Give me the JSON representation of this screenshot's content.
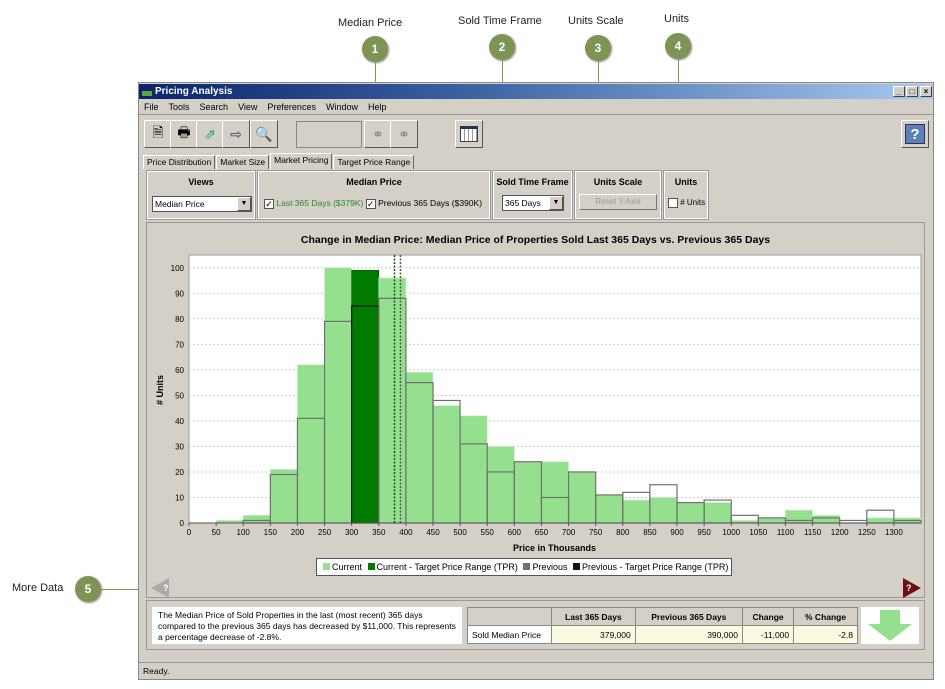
{
  "callouts": [
    {
      "num": "1",
      "label": "Median Price"
    },
    {
      "num": "2",
      "label": "Sold Time Frame"
    },
    {
      "num": "3",
      "label": "Units Scale"
    },
    {
      "num": "4",
      "label": "Units"
    },
    {
      "num": "5",
      "label": "More Data"
    }
  ],
  "window": {
    "title": "Pricing Analysis",
    "controls": [
      "_",
      "□",
      "×"
    ]
  },
  "menu": [
    "File",
    "Tools",
    "Search",
    "View",
    "Preferences",
    "Window",
    "Help"
  ],
  "toolbar": {
    "icons": [
      "print-preview-icon",
      "print-icon",
      "export-chart-icon",
      "export-icon",
      "find-icon",
      "binoculars-icon",
      "binoculars-next-icon",
      "grid-icon",
      "help-icon"
    ],
    "search_value": ""
  },
  "tabs": [
    {
      "label": "Price Distribution"
    },
    {
      "label": "Market Size"
    },
    {
      "label": "Market Pricing",
      "active": true
    },
    {
      "label": "Target Price Range"
    }
  ],
  "controls": {
    "views": {
      "title": "Views",
      "value": "Median Price"
    },
    "median": {
      "title": "Median Price",
      "last": "Last 365 Days ($379K)",
      "prev": "Previous 365 Days ($390K)",
      "last_checked": true,
      "prev_checked": true
    },
    "timeframe": {
      "title": "Sold Time Frame",
      "value": "365 Days"
    },
    "scale": {
      "title": "Units Scale",
      "button": "Reset Y-Axis"
    },
    "units": {
      "title": "Units",
      "label": "# Units",
      "checked": false
    }
  },
  "chart_data": {
    "type": "bar",
    "title": "Change in Median Price: Median Price of Properties Sold Last 365 Days vs. Previous  365 Days",
    "xlabel": "Price in Thousands",
    "ylabel": "# Units",
    "xlim": [
      0,
      1350
    ],
    "ylim": [
      0,
      105
    ],
    "xticks": [
      0,
      50,
      100,
      150,
      200,
      250,
      300,
      350,
      400,
      450,
      500,
      550,
      600,
      650,
      700,
      750,
      800,
      850,
      900,
      950,
      1000,
      1050,
      1100,
      1150,
      1200,
      1250,
      1300
    ],
    "yticks": [
      0,
      10,
      20,
      30,
      40,
      50,
      60,
      70,
      80,
      90,
      100
    ],
    "bin_width": 50,
    "bin_starts": [
      0,
      50,
      100,
      150,
      200,
      250,
      300,
      350,
      400,
      450,
      500,
      550,
      600,
      650,
      700,
      750,
      800,
      850,
      900,
      950,
      1000,
      1050,
      1100,
      1150,
      1200,
      1250,
      1300
    ],
    "series": [
      {
        "name": "Current",
        "color": "#95e08f",
        "values": [
          0,
          1,
          3,
          21,
          62,
          100,
          99,
          96,
          59,
          46,
          42,
          30,
          24,
          24,
          20,
          11,
          9,
          10,
          8,
          8,
          1,
          2,
          5,
          3,
          0,
          2,
          2
        ]
      },
      {
        "name": "Previous",
        "color": "#707070",
        "values": [
          0,
          0,
          1,
          19,
          41,
          79,
          85,
          88,
          55,
          48,
          31,
          20,
          24,
          10,
          20,
          11,
          12,
          15,
          8,
          9,
          3,
          2,
          1,
          2,
          1,
          5,
          1
        ]
      }
    ],
    "tpr_bin_start": 300,
    "tpr_colors": {
      "current": "#007a00",
      "previous": "#0a1a0a"
    },
    "medians": {
      "current": 379,
      "previous": 390
    },
    "grid": true,
    "legend": [
      "Current",
      "Current - Target Price Range (TPR)",
      "Previous",
      "Previous - Target Price Range (TPR)"
    ],
    "legend_position": "bottom"
  },
  "summary": {
    "text": "The Median Price of Sold Properties in the last (most recent) 365 days compared to the previous 365 days has decreased by $11,000. This represents a percentage decrease of -2.8%.",
    "headers": [
      "",
      "Last 365 Days",
      "Previous 365 Days",
      "Change",
      "% Change"
    ],
    "row": [
      "Sold Median Price",
      "379,000",
      "390,000",
      "-11,000",
      "-2.8"
    ],
    "trend": "down"
  },
  "status": "Ready."
}
